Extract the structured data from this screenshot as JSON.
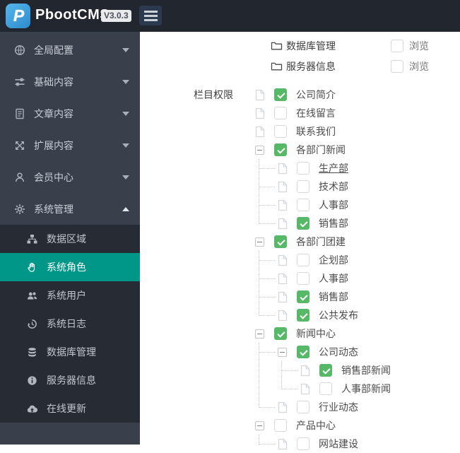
{
  "topbar": {
    "brand": "PbootCMS",
    "version": "V3.0.3",
    "logo_letter": "P"
  },
  "sidebar": {
    "items": [
      {
        "label": "全局配置",
        "icon": "globe-icon"
      },
      {
        "label": "基础内容",
        "icon": "sliders-icon"
      },
      {
        "label": "文章内容",
        "icon": "document-icon"
      },
      {
        "label": "扩展内容",
        "icon": "expand-arrows-icon"
      },
      {
        "label": "会员中心",
        "icon": "user-icon"
      },
      {
        "label": "系统管理",
        "icon": "gear-icon",
        "expanded": true
      }
    ],
    "submenu": [
      {
        "label": "数据区域",
        "icon": "sitemap-icon"
      },
      {
        "label": "系统角色",
        "icon": "hand-icon",
        "active": true
      },
      {
        "label": "系统用户",
        "icon": "users-icon"
      },
      {
        "label": "系统日志",
        "icon": "history-icon"
      },
      {
        "label": "数据库管理",
        "icon": "database-icon"
      },
      {
        "label": "服务器信息",
        "icon": "info-icon"
      },
      {
        "label": "在线更新",
        "icon": "cloud-upload-icon"
      }
    ]
  },
  "main": {
    "permission_rows": [
      {
        "label": "数据库管理",
        "action": "浏览",
        "checked": false
      },
      {
        "label": "服务器信息",
        "action": "浏览",
        "checked": false
      }
    ],
    "column_permission_label": "栏目权限",
    "tree": [
      {
        "label": "公司简介",
        "checked": true
      },
      {
        "label": "在线留言",
        "checked": false
      },
      {
        "label": "联系我们",
        "checked": false
      },
      {
        "label": "各部门新闻",
        "checked": true,
        "children": [
          {
            "label": "生产部",
            "checked": false,
            "underline": true
          },
          {
            "label": "技术部",
            "checked": false
          },
          {
            "label": "人事部",
            "checked": false
          },
          {
            "label": "销售部",
            "checked": true
          }
        ]
      },
      {
        "label": "各部门团建",
        "checked": true,
        "children": [
          {
            "label": "企划部",
            "checked": false
          },
          {
            "label": "人事部",
            "checked": false
          },
          {
            "label": "销售部",
            "checked": true
          },
          {
            "label": "公共发布",
            "checked": true
          }
        ]
      },
      {
        "label": "新闻中心",
        "checked": true,
        "children": [
          {
            "label": "公司动态",
            "checked": true,
            "children": [
              {
                "label": "销售部新闻",
                "checked": true
              },
              {
                "label": "人事部新闻",
                "checked": false
              }
            ]
          },
          {
            "label": "行业动态",
            "checked": false
          }
        ]
      },
      {
        "label": "产品中心",
        "checked": false,
        "children": [
          {
            "label": "网站建设",
            "checked": false
          }
        ]
      }
    ]
  },
  "colors": {
    "topbar_bg": "#22262f",
    "sidebar_bg": "#3a3f4c",
    "submenu_bg": "#272b34",
    "active_teal": "#009688",
    "check_green": "#57b868",
    "logo_blue": "#3f9fdc"
  }
}
